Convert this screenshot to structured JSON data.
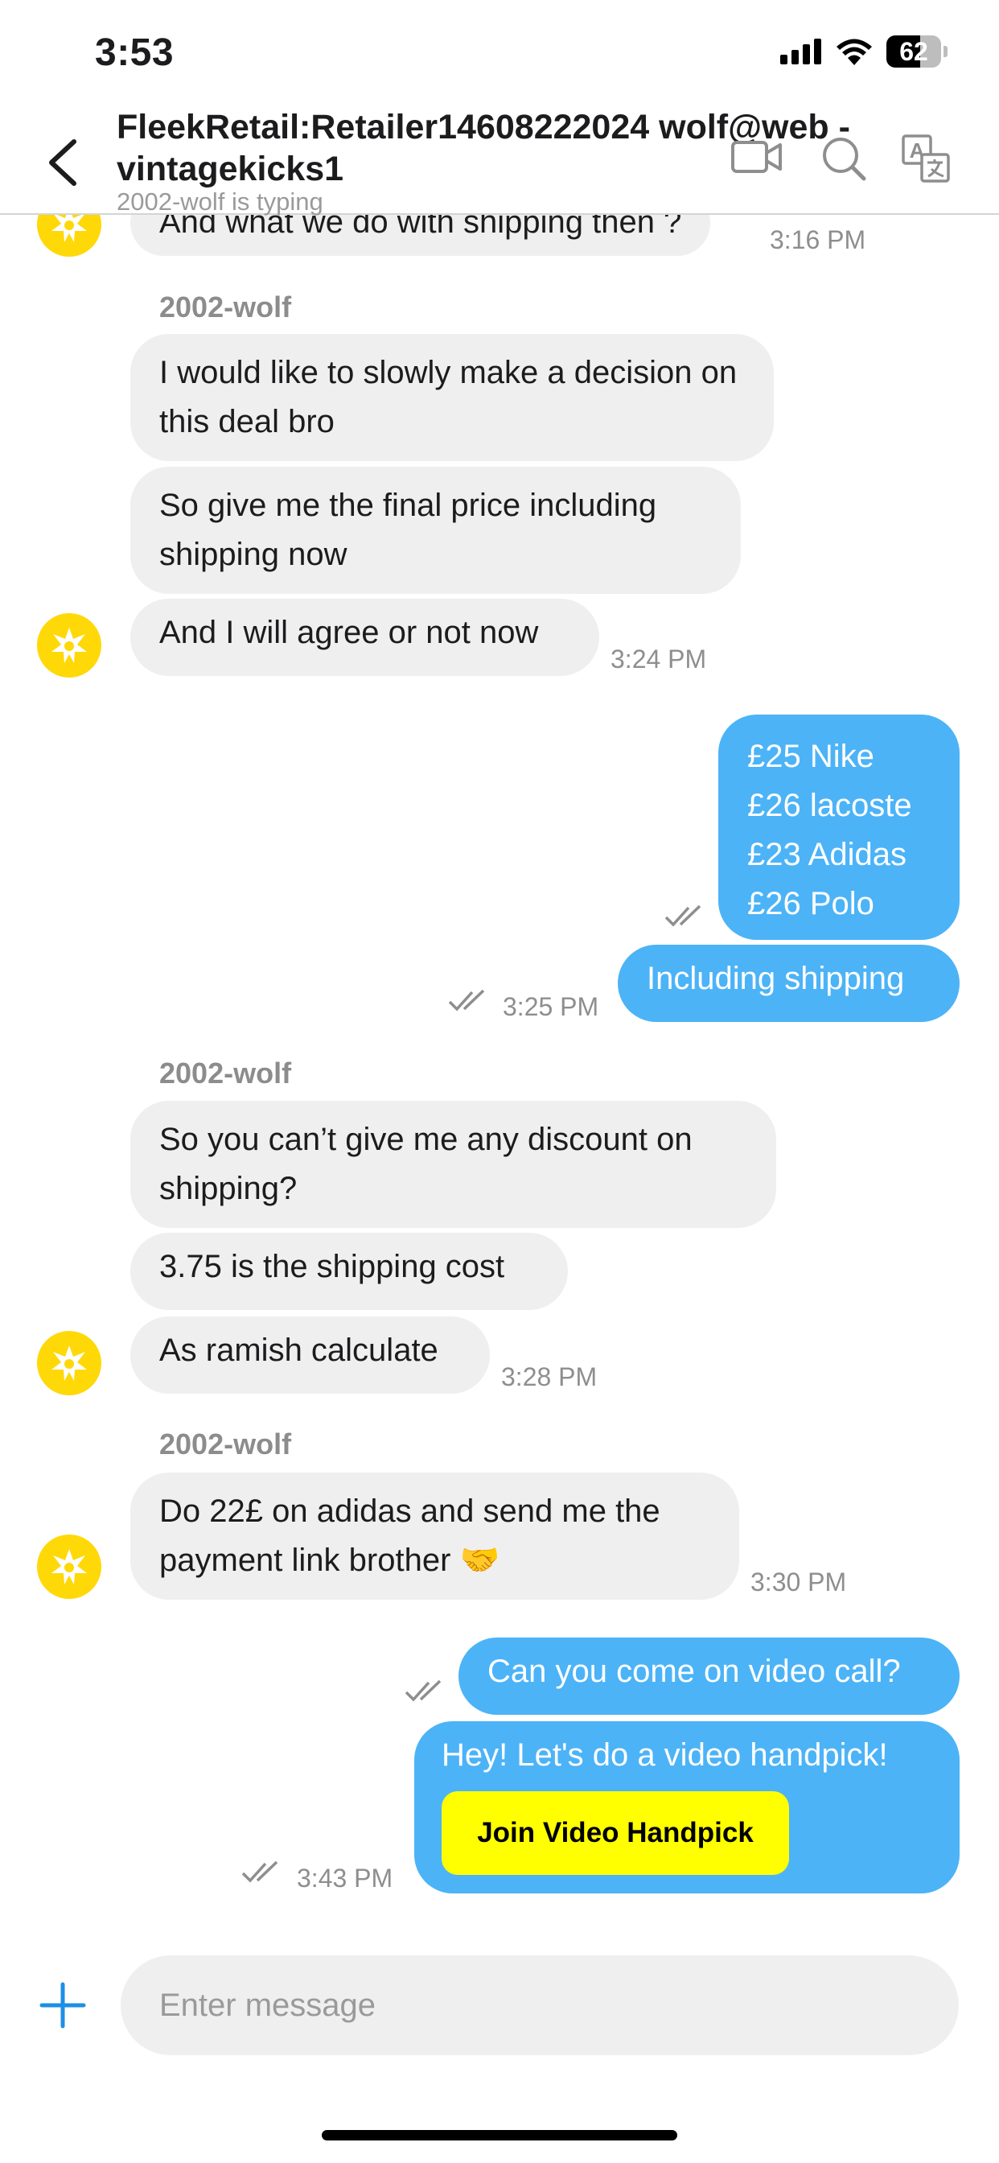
{
  "status_bar": {
    "time": "3:53",
    "battery": "62",
    "battery_level": 0.62,
    "icons": [
      "signal-icon",
      "wifi-icon",
      "battery-icon"
    ]
  },
  "header": {
    "title": "FleekRetail:Retailer14608222024 wolf@web - vintagekicks1",
    "subtitle": "2002-wolf is typing",
    "icons": [
      "back-chevron-icon",
      "video-camera-icon",
      "search-icon",
      "translate-icon"
    ]
  },
  "messages": {
    "m0": {
      "text": "And what we do with shipping then ?",
      "time": "3:16 PM"
    },
    "g1": {
      "sender": "2002-wolf",
      "m1": "I would like to slowly make a decision on this deal bro",
      "m2": "So give me the final price including shipping now",
      "m3": "And I will agree or not now",
      "time": "3:24 PM"
    },
    "o1": {
      "m1": "£25 Nike\n£26 lacoste\n£23 Adidas\n£26 Polo",
      "m2": "Including shipping",
      "time": "3:25 PM"
    },
    "g2": {
      "sender": "2002-wolf",
      "m1": "So you can’t give me any discount on shipping?",
      "m2": "3.75 is the shipping cost",
      "m3": "As ramish calculate",
      "time": "3:28 PM"
    },
    "g3": {
      "sender": "2002-wolf",
      "m1": "Do 22£ on adidas and send me the payment link brother 🤝",
      "time": "3:30 PM"
    },
    "o2": {
      "m1": "Can you come on video call?",
      "m2": "Hey! Let's do a video handpick!",
      "button": "Join Video Handpick",
      "time": "3:43 PM"
    }
  },
  "composer": {
    "placeholder": "Enter message"
  },
  "colors": {
    "outgoing": "#4cb3f7",
    "incoming": "#efefef",
    "avatar": "#ffd808",
    "cta": "#ffff00"
  }
}
